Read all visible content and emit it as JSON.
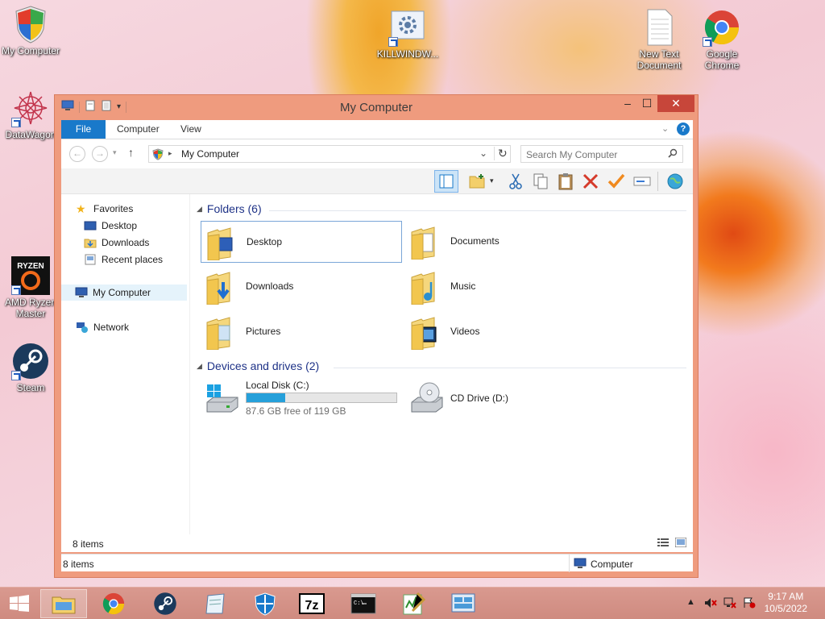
{
  "desktop": {
    "icons": [
      {
        "label": "My Computer"
      },
      {
        "label": "DataWagon"
      },
      {
        "label": "AMD Ryzen\nMaster"
      },
      {
        "label": "Steam"
      },
      {
        "label": "KILLWINDW..."
      },
      {
        "label": "New Text\nDocument"
      },
      {
        "label": "Google\nChrome"
      }
    ]
  },
  "window": {
    "title": "My Computer",
    "controls": {
      "minimize": "‒",
      "maximize": "☐",
      "close": "✕"
    },
    "ribbon_tabs": [
      "File",
      "Computer",
      "View"
    ],
    "address": {
      "path": "My Computer",
      "search_placeholder": "Search My Computer"
    },
    "nav": {
      "favorites": "Favorites",
      "favorites_items": [
        "Desktop",
        "Downloads",
        "Recent places"
      ],
      "my_computer": "My Computer",
      "network": "Network"
    },
    "folders_header": "Folders (6)",
    "folders": [
      "Desktop",
      "Documents",
      "Downloads",
      "Music",
      "Pictures",
      "Videos"
    ],
    "devices_header": "Devices and drives (2)",
    "drives": [
      {
        "name": "Local Disk (C:)",
        "free_text": "87.6 GB free of 119 GB",
        "used_fraction": 0.26
      },
      {
        "name": "CD Drive (D:)"
      }
    ],
    "status_inner": "8 items",
    "status_bottom": "8 items",
    "status_right": "Computer"
  },
  "taskbar": {
    "time": "9:17 AM",
    "date": "10/5/2022"
  },
  "colors": {
    "accent": "#1979ca",
    "window_frame": "#ef9b7e",
    "close": "#c7463a",
    "progress": "#26a0da",
    "group_header": "#1e3287"
  }
}
